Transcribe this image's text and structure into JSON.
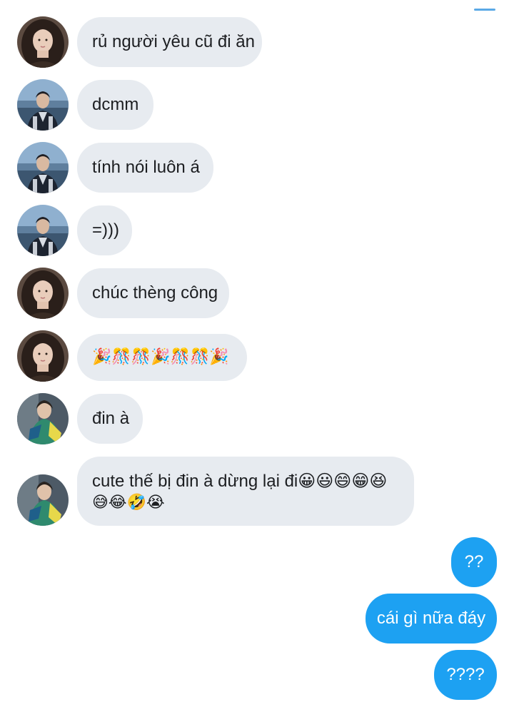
{
  "messages": [
    {
      "id": "m1",
      "sender": "girl",
      "text": "rủ người yêu cũ đi ăn"
    },
    {
      "id": "m2",
      "sender": "boy1",
      "text": "dcmm"
    },
    {
      "id": "m3",
      "sender": "boy1",
      "text": "tính nói luôn á"
    },
    {
      "id": "m4",
      "sender": "boy1",
      "text": "=)))"
    },
    {
      "id": "m5",
      "sender": "girl",
      "text": "chúc thèng công"
    },
    {
      "id": "m6",
      "sender": "girl",
      "text": "🎉🎊🎊🎉🎊🎊🎉"
    },
    {
      "id": "m7",
      "sender": "boy2",
      "text": "đin à"
    },
    {
      "id": "m8",
      "sender": "boy2",
      "text_line1": "cute thế bị đin à dừng lại đi😀😃😄😁😆",
      "text_line2": "😅😂🤣😭"
    },
    {
      "id": "m9",
      "sender": "me",
      "text": "??"
    },
    {
      "id": "m10",
      "sender": "me",
      "text": "cái gì nữa đáy"
    },
    {
      "id": "m11",
      "sender": "me",
      "text": "????"
    }
  ],
  "colors": {
    "incoming_bubble": "#e7ebf0",
    "outgoing_bubble": "#1da1f2",
    "incoming_text": "#1c1e21",
    "outgoing_text": "#ffffff"
  },
  "avatars": {
    "girl": "avatar-girl-long-hair",
    "boy1": "avatar-boy-seaside",
    "boy2": "avatar-boy-green-jacket"
  }
}
